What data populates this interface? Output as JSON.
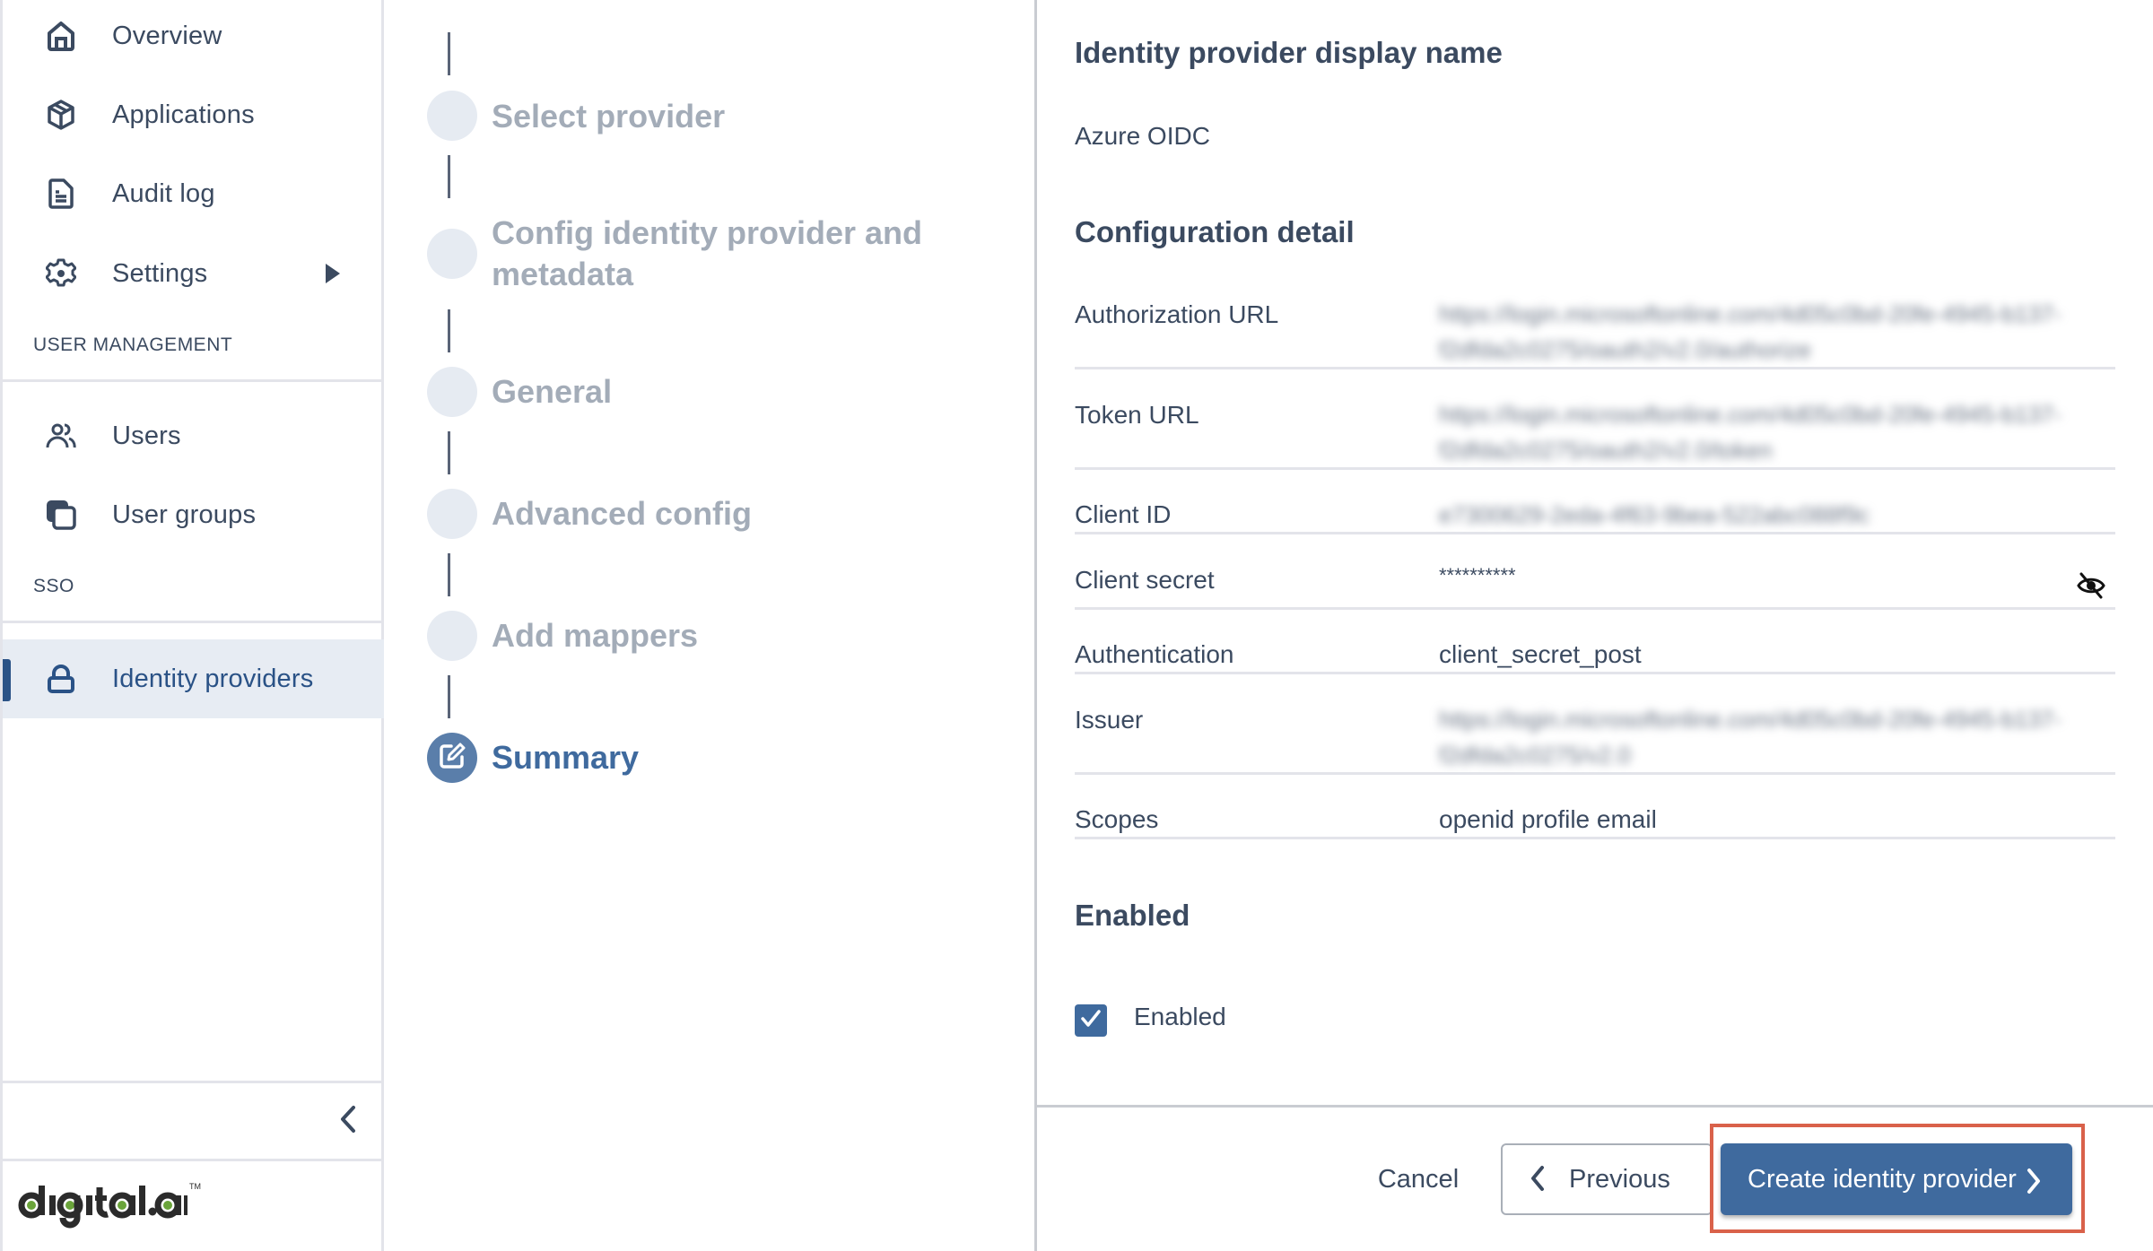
{
  "sidebar": {
    "nav": [
      {
        "label": "Overview",
        "icon": "home-icon"
      },
      {
        "label": "Applications",
        "icon": "package-icon"
      },
      {
        "label": "Audit log",
        "icon": "document-icon"
      },
      {
        "label": "Settings",
        "icon": "gear-icon",
        "has_submenu": true
      }
    ],
    "sections": [
      {
        "title": "USER MANAGEMENT",
        "items": [
          {
            "label": "Users",
            "icon": "users-icon"
          },
          {
            "label": "User groups",
            "icon": "user-groups-icon"
          }
        ]
      },
      {
        "title": "SSO",
        "items": [
          {
            "label": "Identity providers",
            "icon": "lock-icon",
            "active": true
          }
        ]
      }
    ],
    "collapse_icon": "chevron-left-icon",
    "logo_text": "digital.ai",
    "logo_tm": "TM"
  },
  "stepper": {
    "steps": [
      {
        "label": "Select provider",
        "state": "pending"
      },
      {
        "label": "Config identity provider and metadata",
        "state": "pending"
      },
      {
        "label": "General",
        "state": "pending"
      },
      {
        "label": "Advanced config",
        "state": "pending"
      },
      {
        "label": "Add mappers",
        "state": "pending"
      },
      {
        "label": "Summary",
        "state": "current",
        "icon": "edit-icon"
      }
    ]
  },
  "summary": {
    "display_name_title": "Identity provider display name",
    "display_name_value": "Azure OIDC",
    "config_title": "Configuration detail",
    "config_rows": [
      {
        "key": "Authorization URL",
        "value": "https://login.microsoftonline.com/4d05c0bd-20fe-4945-b137-f2dfda2c0275/oauth2/v2.0/authorize",
        "blurred": true
      },
      {
        "key": "Token URL",
        "value": "https://login.microsoftonline.com/4d05c0bd-20fe-4945-b137-f2dfda2c0275/oauth2/v2.0/token",
        "blurred": true
      },
      {
        "key": "Client ID",
        "value": "e7300629-2eda-4f63-9bea-522abc088f9c",
        "blurred": true
      },
      {
        "key": "Client secret",
        "value": "**********",
        "blurred": false,
        "toggle_icon": "eye-off-icon"
      },
      {
        "key": "Authentication",
        "value": "client_secret_post",
        "blurred": false
      },
      {
        "key": "Issuer",
        "value": "https://login.microsoftonline.com/4d05c0bd-20fe-4945-b137-f2dfda2c0275/v2.0",
        "blurred": true
      },
      {
        "key": "Scopes",
        "value": "openid profile email",
        "blurred": false
      }
    ],
    "enabled_title": "Enabled",
    "enabled_checkbox_label": "Enabled",
    "enabled_checked": true
  },
  "footer": {
    "cancel_label": "Cancel",
    "previous_label": "Previous",
    "create_label": "Create identity provider"
  },
  "colors": {
    "accent": "#3f6a9e",
    "active_nav": "#2a5286",
    "highlight": "#d9614a"
  }
}
